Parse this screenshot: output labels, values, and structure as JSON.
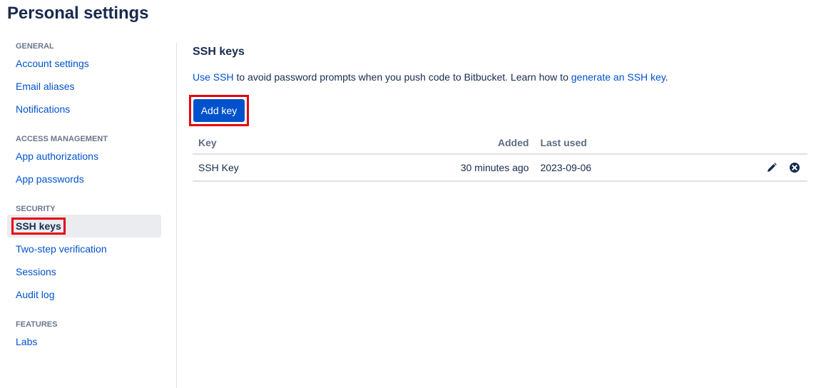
{
  "page": {
    "title": "Personal settings"
  },
  "sidebar": {
    "groups": [
      {
        "heading": "GENERAL",
        "items": [
          "Account settings",
          "Email aliases",
          "Notifications"
        ]
      },
      {
        "heading": "ACCESS MANAGEMENT",
        "items": [
          "App authorizations",
          "App passwords"
        ]
      },
      {
        "heading": "SECURITY",
        "items": [
          "SSH keys",
          "Two-step verification",
          "Sessions",
          "Audit log"
        ]
      },
      {
        "heading": "FEATURES",
        "items": [
          "Labs"
        ]
      }
    ],
    "selected": "SSH keys"
  },
  "main": {
    "title": "SSH keys",
    "intro": {
      "link1": "Use SSH",
      "text1": " to avoid password prompts when you push code to Bitbucket. Learn how to ",
      "link2": "generate an SSH key",
      "text2": "."
    },
    "add_button": "Add key",
    "table": {
      "headers": {
        "key": "Key",
        "added": "Added",
        "last_used": "Last used"
      },
      "rows": [
        {
          "key": "SSH Key",
          "added": "30 minutes ago",
          "last_used": "2023-09-06"
        }
      ]
    }
  },
  "icons": {
    "edit": "pencil-icon",
    "delete": "close-circle-icon"
  },
  "colors": {
    "link": "#0052cc",
    "primary_button": "#0052cc",
    "highlight_box": "#e8000b",
    "selected_bg": "#ebecf0"
  }
}
